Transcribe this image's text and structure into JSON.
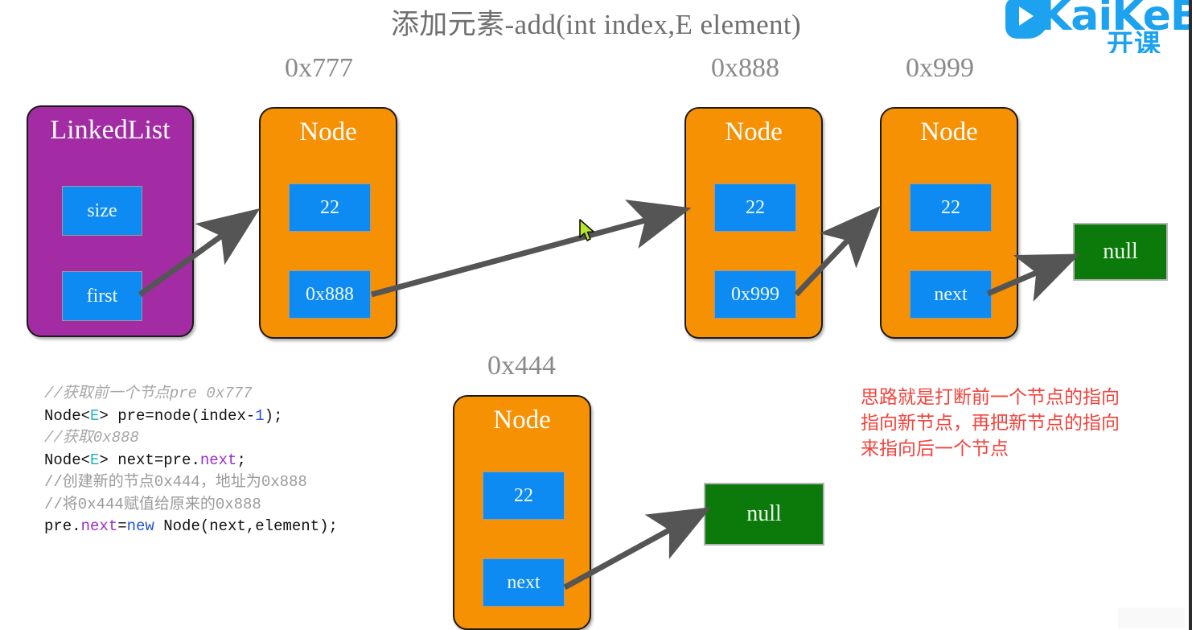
{
  "slide": {
    "title": "添加元素-add(int index,E element)"
  },
  "logo": {
    "word": "KaiKeB",
    "cn": "开课",
    "mark_icon": "kaikeba-play-mark-icon"
  },
  "linked_list": {
    "title": "LinkedList",
    "fields": [
      {
        "label": "size"
      },
      {
        "label": "first"
      }
    ]
  },
  "nodes": [
    {
      "address": "0x777",
      "title": "Node",
      "value": "22",
      "next": "0x888"
    },
    {
      "address": "0x888",
      "title": "Node",
      "value": "22",
      "next": "0x999"
    },
    {
      "address": "0x999",
      "title": "Node",
      "value": "22",
      "next": "next"
    },
    {
      "address": "0x444",
      "title": "Node",
      "value": "22",
      "next": "next"
    }
  ],
  "null_boxes": [
    {
      "label": "null"
    },
    {
      "label": "null"
    }
  ],
  "code": {
    "line1_comment": "//获取前一个节点pre 0x777",
    "line2_a": "Node<",
    "line2_e": "E",
    "line2_b": "> pre=node(index-",
    "line2_num": "1",
    "line2_c": ");",
    "line3_comment": "//获取0x888",
    "line4_a": "Node<",
    "line4_e": "E",
    "line4_b": "> next=pre.",
    "line4_prop": "next",
    "line4_c": ";",
    "line5_comment": "//创建新的节点0x444，地址为0x888",
    "line6_comment": "//将0x444赋值给原来的0x888",
    "line7_a": "pre.",
    "line7_prop": "next",
    "line7_b": "=",
    "line7_kw": "new",
    "line7_c": " Node(next,element);"
  },
  "note": {
    "text": "思路就是打断前一个节点的指向\n指向新节点，再把新节点的指向\n来指向后一个节点"
  },
  "colors": {
    "list_box": "#a32ba3",
    "node_box": "#f79104",
    "field_box": "#0d8bf2",
    "null_box": "#0b7a0b",
    "arrow": "#555555",
    "note_red": "#f2433c",
    "address_gray": "#8a8a8a",
    "brand_blue": "#1ca2ef"
  }
}
